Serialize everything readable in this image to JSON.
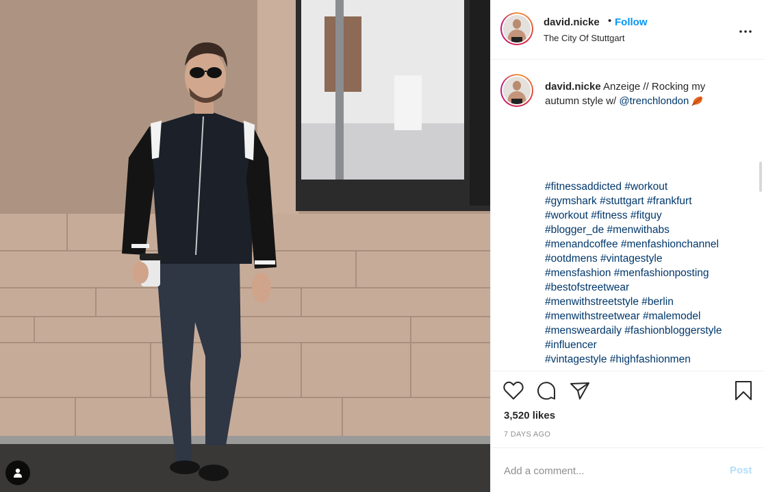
{
  "post": {
    "username": "david.nicke",
    "follow_separator": "•",
    "follow_label": "Follow",
    "location": "The City Of Stuttgart",
    "more_icon": "more-options-icon"
  },
  "caption": {
    "username": "david.nicke",
    "text": "Anzeige // Rocking my autumn style w/",
    "mention": "@trenchlondon",
    "emoji_icon": "fallen-leaf-icon",
    "hashtag_lines": [
      "#fitnessaddicted #workout",
      "#gymshark #stuttgart #frankfurt",
      "#workout #fitness #fitguy",
      "#blogger_de #menwithabs",
      "#menandcoffee #menfashionchannel",
      "#ootdmens #vintagestyle",
      "#mensfashion #menfashionposting",
      "#bestofstreetwear",
      "#menwithstreetstyle #berlin",
      "#menwithstreetwear #malemodel",
      "#mensweardaily #fashionbloggerstyle",
      "#influencer",
      "#vintagestyle  #highfashionmen"
    ]
  },
  "actions": {
    "like_icon": "heart-icon",
    "comment_icon": "comment-icon",
    "share_icon": "share-icon",
    "save_icon": "bookmark-icon",
    "likes": "3,520 likes",
    "time_ago": "7 DAYS AGO"
  },
  "comment_box": {
    "placeholder": "Add a comment...",
    "post_label": "Post"
  },
  "colors": {
    "link": "#00376b",
    "follow": "#0095f6",
    "post_disabled": "#b2dffc",
    "muted": "#8e8e8e"
  }
}
